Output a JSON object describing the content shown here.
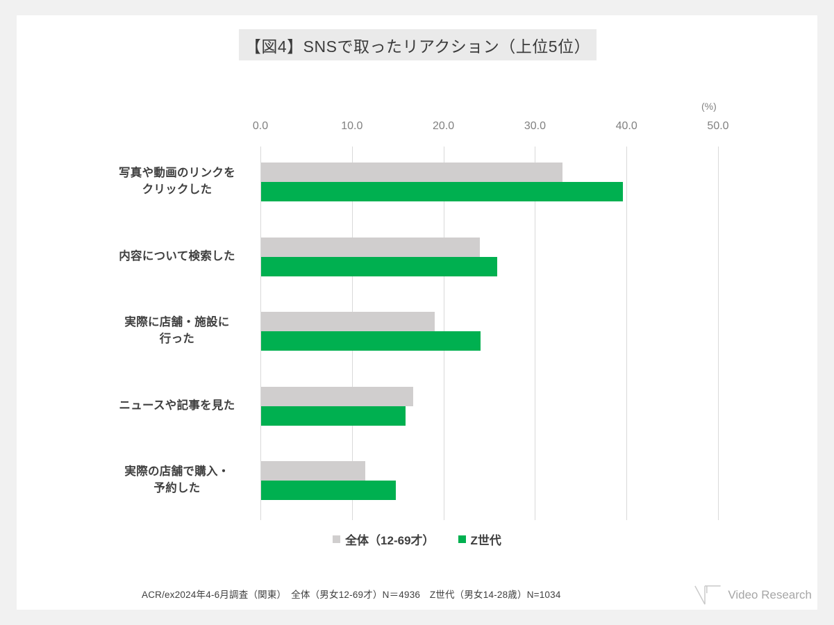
{
  "title": "【図4】SNSで取ったリアクション（上位5位）",
  "legend": [
    {
      "label": "全体（12-69才）",
      "color": "#d0cece"
    },
    {
      "label": "Z世代",
      "color": "#00b050"
    }
  ],
  "footer": {
    "note": "ACR/ex2024年4-6月調査（関東）　全体（男女12-69才）N＝4936　Z世代（男女14-28歳）N=1034",
    "logo_text": "Video Research",
    "logo_icon": "video-research-mark"
  },
  "chart_data": {
    "type": "bar",
    "orientation": "horizontal",
    "title": "【図4】SNSで取ったリアクション（上位5位）",
    "xlabel": "(%)",
    "ylabel": "",
    "xlim": [
      0,
      50
    ],
    "xticks": [
      "0.0",
      "10.0",
      "20.0",
      "30.0",
      "40.0",
      "50.0"
    ],
    "xtick_values": [
      0,
      10,
      20,
      30,
      40,
      50
    ],
    "grid": true,
    "legend_position": "bottom",
    "unit": "(%)",
    "categories": [
      "写真や動画のリンクを\nクリックした",
      "内容について検索した",
      "実際に店舗・施設に\n行った",
      "ニュースや記事を見た",
      "実際の店舗で購入・\n予約した"
    ],
    "category_lines": [
      [
        "写真や動画のリンクを",
        "クリックした"
      ],
      [
        "内容について検索した"
      ],
      [
        "実際に店舗・施設に",
        "行った"
      ],
      [
        "ニュースや記事を見た"
      ],
      [
        "実際の店舗で購入・",
        "予約した"
      ]
    ],
    "series": [
      {
        "name": "全体（12-69才）",
        "color": "#d0cece",
        "values": [
          32.9,
          23.9,
          19.0,
          16.6,
          11.4
        ]
      },
      {
        "name": "Z世代",
        "color": "#00b050",
        "values": [
          39.5,
          25.8,
          24.0,
          15.8,
          14.7
        ]
      }
    ]
  }
}
